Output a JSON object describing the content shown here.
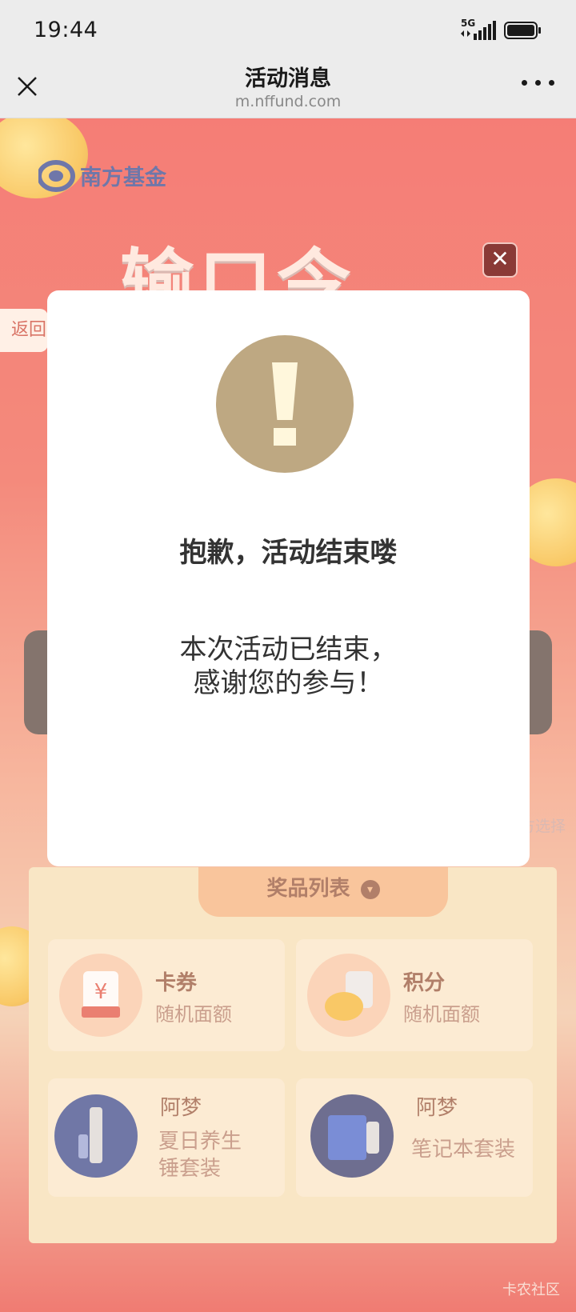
{
  "status_bar": {
    "time": "19:44",
    "network": "5G",
    "icons": [
      "signal-icon",
      "battery-icon"
    ]
  },
  "nav": {
    "title": "活动消息",
    "url": "m.nffund.com",
    "close_icon": "close-icon",
    "more_icon": "more-icon"
  },
  "background": {
    "brand": "南方基金",
    "hero_title": "输口令",
    "back_label": "返回",
    "right_side_text": "方选择",
    "prize_panel": {
      "title": "奖品列表",
      "items": [
        {
          "name": "卡券",
          "sub": "随机面额",
          "thumb_label": "红包券"
        },
        {
          "name": "积分",
          "sub": "随机面额"
        },
        {
          "name": "阿梦",
          "sub_line1": "夏日养生",
          "sub_line2": "锤套装"
        },
        {
          "name": "阿梦",
          "sub": "笔记本套装"
        }
      ]
    },
    "watermark": "卡农社区"
  },
  "dialog": {
    "icon": "warning-icon",
    "title": "抱歉，活动结束喽",
    "message_line1": "本次活动已结束，",
    "message_line2": "感谢您的参与！",
    "close_icon": "close-icon"
  },
  "colors": {
    "page_red": "#f04842",
    "dialog_bg": "#ffffff",
    "warning_circle": "#bea882",
    "prize_panel": "#f7e2b6"
  }
}
